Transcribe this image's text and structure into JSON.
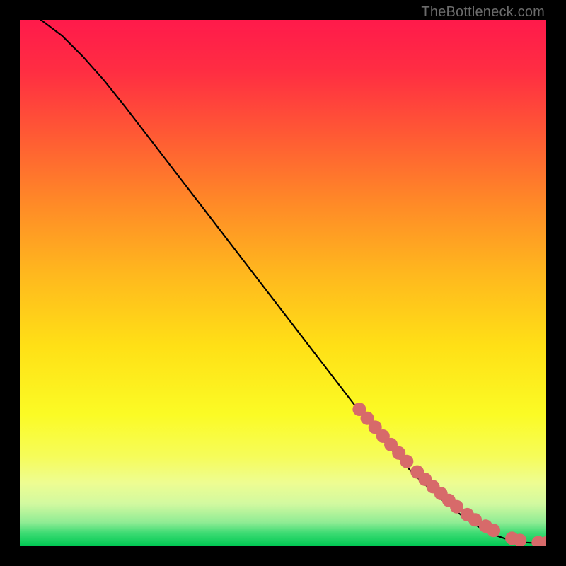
{
  "watermark": "TheBottleneck.com",
  "chart_data": {
    "type": "line",
    "title": "",
    "xlabel": "",
    "ylabel": "",
    "xlim": [
      0,
      100
    ],
    "ylim": [
      0,
      100
    ],
    "grid": false,
    "legend": false,
    "series": [
      {
        "name": "curve",
        "style": "line",
        "color": "#000000",
        "x": [
          4,
          8,
          12,
          16,
          20,
          25,
          30,
          35,
          40,
          45,
          50,
          55,
          60,
          65,
          70,
          75,
          80,
          85,
          88,
          90,
          92,
          94,
          96,
          98,
          100
        ],
        "y": [
          100,
          97,
          93,
          88.5,
          83.5,
          77,
          70.5,
          64,
          57.5,
          51,
          44.5,
          38,
          31.5,
          25,
          19,
          13.5,
          9,
          5,
          3.2,
          2.2,
          1.5,
          1.0,
          0.7,
          0.6,
          0.6
        ]
      },
      {
        "name": "points",
        "style": "marker",
        "color": "#d76a6a",
        "x": [
          64.5,
          66,
          67.5,
          69,
          70.5,
          72,
          73.5,
          75.5,
          77,
          78.5,
          80,
          81.5,
          83,
          85,
          86.5,
          88.5,
          90,
          93.5,
          95,
          98.5,
          100
        ],
        "y": [
          26,
          24.3,
          22.6,
          20.9,
          19.3,
          17.7,
          16.1,
          14.1,
          12.7,
          11.3,
          10.0,
          8.7,
          7.5,
          6.0,
          5.0,
          3.8,
          3.0,
          1.5,
          1.1,
          0.7,
          0.6
        ]
      }
    ],
    "gradient_stops": [
      {
        "offset": 0.0,
        "color": "#FF1A4B"
      },
      {
        "offset": 0.1,
        "color": "#FF2E42"
      },
      {
        "offset": 0.22,
        "color": "#FF5A34"
      },
      {
        "offset": 0.35,
        "color": "#FF8A27"
      },
      {
        "offset": 0.48,
        "color": "#FFB71E"
      },
      {
        "offset": 0.62,
        "color": "#FFE016"
      },
      {
        "offset": 0.75,
        "color": "#FBFB25"
      },
      {
        "offset": 0.83,
        "color": "#F6FC5A"
      },
      {
        "offset": 0.88,
        "color": "#EEFD92"
      },
      {
        "offset": 0.92,
        "color": "#D1F9A0"
      },
      {
        "offset": 0.955,
        "color": "#8FEC94"
      },
      {
        "offset": 0.975,
        "color": "#3DDB73"
      },
      {
        "offset": 1.0,
        "color": "#00C853"
      }
    ]
  }
}
